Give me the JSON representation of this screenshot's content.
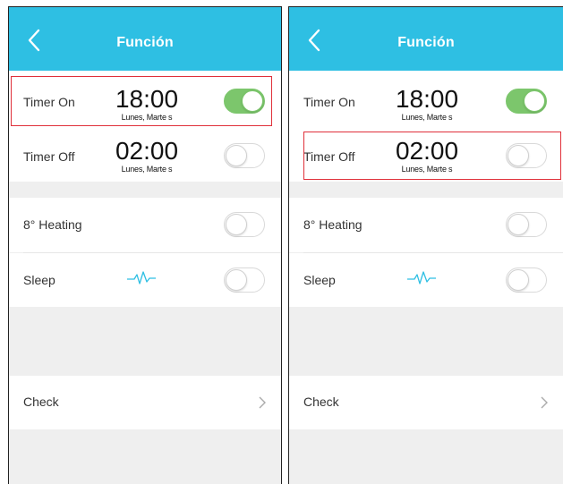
{
  "colors": {
    "header_bg": "#2ebfe3",
    "toggle_on": "#7cc66c",
    "highlight": "#e0303a",
    "page_bg": "#efefef"
  },
  "screens": [
    {
      "header": {
        "title": "Función",
        "back_icon": "chevron-left-icon"
      },
      "timer_on": {
        "label": "Timer On",
        "time": "18:00",
        "days": "Lunes, Marte s",
        "toggle": "on"
      },
      "timer_off": {
        "label": "Timer Off",
        "time": "02:00",
        "days": "Lunes, Marte s",
        "toggle": "off"
      },
      "heating": {
        "label": "8° Heating",
        "toggle": "off"
      },
      "sleep": {
        "label": "Sleep",
        "icon": "pulse-icon",
        "toggle": "off"
      },
      "check": {
        "label": "Check",
        "icon": "chevron-right-icon"
      },
      "highlighted_row": "timer_on"
    },
    {
      "header": {
        "title": "Función",
        "back_icon": "chevron-left-icon"
      },
      "timer_on": {
        "label": "Timer On",
        "time": "18:00",
        "days": "Lunes, Marte s",
        "toggle": "on"
      },
      "timer_off": {
        "label": "Timer Off",
        "time": "02:00",
        "days": "Lunes, Marte s",
        "toggle": "off"
      },
      "heating": {
        "label": "8° Heating",
        "toggle": "off"
      },
      "sleep": {
        "label": "Sleep",
        "icon": "pulse-icon",
        "toggle": "off"
      },
      "check": {
        "label": "Check",
        "icon": "chevron-right-icon"
      },
      "highlighted_row": "timer_off"
    }
  ]
}
